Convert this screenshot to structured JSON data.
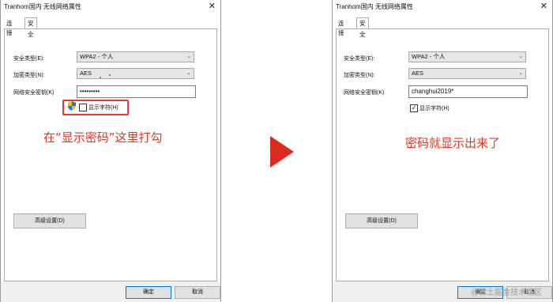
{
  "left": {
    "title": "Tranhom国内 无线网络属性",
    "tabs": [
      "连接",
      "安全"
    ],
    "security_type_label": "安全类型(E):",
    "security_type_value": "WPA2 - 个人",
    "encryption_type_label": "加密类型(N):",
    "encryption_type_value": "AES",
    "network_key_label": "网络安全密钥(K)",
    "network_key_value": "•••••••••",
    "show_chars_label": "显示字符(H)",
    "show_chars_checked": false,
    "advanced_button": "高级设置(D)",
    "ok_button": "确定",
    "cancel_button": "取消",
    "annotation": "在“显示密码”这里打勾"
  },
  "right": {
    "title": "Tranhom国内 无线网络属性",
    "tabs": [
      "连接",
      "安全"
    ],
    "security_type_label": "安全类型(E):",
    "security_type_value": "WPA2 - 个人",
    "encryption_type_label": "加密类型(N):",
    "encryption_type_value": "AES",
    "network_key_label": "网络安全密钥(K)",
    "network_key_value": "changhui2019*",
    "show_chars_label": "显示字符(H)",
    "show_chars_checked": true,
    "checkbox_mark": "✓",
    "advanced_button": "高级设置(D)",
    "ok_button": "确定",
    "cancel_button": "取消",
    "annotation": "密码就显示出来了"
  },
  "close_glyph": "✕",
  "select_arrow": "⌄",
  "watermark": "@稀土掘金技术社区",
  "colors": {
    "annotation": "#e8341c",
    "arrow": "#d92b20",
    "highlight_box": "#e53935"
  },
  "icons": [
    "shield-icon",
    "close-icon",
    "next-arrow-icon"
  ]
}
